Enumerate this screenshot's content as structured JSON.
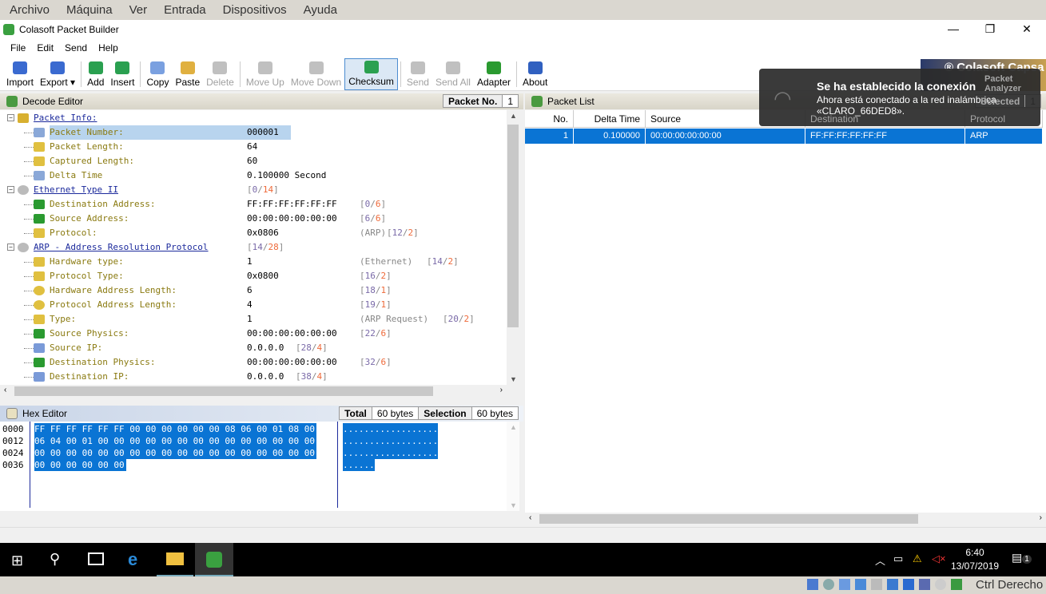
{
  "vbox_menu": [
    "Archivo",
    "Máquina",
    "Ver",
    "Entrada",
    "Dispositivos",
    "Ayuda"
  ],
  "app_title": "Colasoft Packet Builder",
  "menu": [
    "File",
    "Edit",
    "Send",
    "Help"
  ],
  "toolbar": [
    {
      "label": "Import",
      "state": "normal",
      "color": "#3a6ad0"
    },
    {
      "label": "Export ▾",
      "state": "normal",
      "color": "#3a6ad0"
    },
    {
      "sep": true
    },
    {
      "label": "Add",
      "state": "normal",
      "color": "#2aa050"
    },
    {
      "label": "Insert",
      "state": "normal",
      "color": "#2aa050"
    },
    {
      "sep": true
    },
    {
      "label": "Copy",
      "state": "normal",
      "color": "#7aa0e0"
    },
    {
      "label": "Paste",
      "state": "normal",
      "color": "#e0b040"
    },
    {
      "label": "Delete",
      "state": "disabled",
      "color": "#c0c0c0"
    },
    {
      "sep": true
    },
    {
      "label": "Move Up",
      "state": "disabled",
      "color": "#c0c0c0"
    },
    {
      "label": "Move Down",
      "state": "disabled",
      "color": "#c0c0c0"
    },
    {
      "label": "Checksum",
      "state": "active",
      "color": "#2aa050"
    },
    {
      "sep": true
    },
    {
      "label": "Send",
      "state": "disabled",
      "color": "#c0c0c0"
    },
    {
      "label": "Send All",
      "state": "disabled",
      "color": "#c0c0c0"
    },
    {
      "label": "Adapter",
      "state": "normal",
      "color": "#2a9a30"
    },
    {
      "sep": true
    },
    {
      "label": "About",
      "state": "normal",
      "color": "#3060c0"
    }
  ],
  "banner": "® Colasoft Capsa",
  "banner_sub": "Packet Analyzer",
  "decode_editor": {
    "title": "Decode Editor",
    "packet_no_label": "Packet No.",
    "packet_no": "1",
    "rows": [
      {
        "level": 0,
        "label": "Packet Info:",
        "icon": "packet-info",
        "header": true
      },
      {
        "level": 1,
        "label": "Packet Number:",
        "value": "000001",
        "icon": "document",
        "selected": true
      },
      {
        "level": 1,
        "label": "Packet Length:",
        "value": "64",
        "icon": "field"
      },
      {
        "level": 1,
        "label": "Captured Length:",
        "value": "60",
        "icon": "field"
      },
      {
        "level": 1,
        "label": "Delta Time",
        "value": "0.100000 Second",
        "icon": "document"
      },
      {
        "level": 0,
        "label": "Ethernet Type II",
        "icon": "protocol",
        "header": true,
        "rs": "0",
        "rl": "14"
      },
      {
        "level": 1,
        "label": "Destination Address:",
        "value": "FF:FF:FF:FF:FF:FF",
        "icon": "mac",
        "rs": "0",
        "rl": "6"
      },
      {
        "level": 1,
        "label": "Source Address:",
        "value": "00:00:00:00:00:00",
        "icon": "mac",
        "rs": "6",
        "rl": "6"
      },
      {
        "level": 1,
        "label": "Protocol:",
        "value": "0x0806",
        "extra": "(ARP)",
        "icon": "field",
        "rs": "12",
        "rl": "2"
      },
      {
        "level": 0,
        "label": "ARP - Address Resolution Protocol",
        "icon": "protocol",
        "header": true,
        "rs": "14",
        "rl": "28"
      },
      {
        "level": 1,
        "label": "Hardware type:",
        "value": "1",
        "extra": "(Ethernet)",
        "icon": "field",
        "rs": "14",
        "rl": "2"
      },
      {
        "level": 1,
        "label": "Protocol Type:",
        "value": "0x0800",
        "icon": "field",
        "rs": "16",
        "rl": "2"
      },
      {
        "level": 1,
        "label": "Hardware Address Length:",
        "value": "6",
        "icon": "round",
        "rs": "18",
        "rl": "1"
      },
      {
        "level": 1,
        "label": "Protocol Address Length:",
        "value": "4",
        "icon": "round",
        "rs": "19",
        "rl": "1"
      },
      {
        "level": 1,
        "label": "Type:",
        "value": "1",
        "extra": "(ARP Request)",
        "icon": "field",
        "rs": "20",
        "rl": "2"
      },
      {
        "level": 1,
        "label": "Source Physics:",
        "value": "00:00:00:00:00:00",
        "icon": "mac",
        "rs": "22",
        "rl": "6"
      },
      {
        "level": 1,
        "label": "Source IP:",
        "value": "0.0.0.0",
        "icon": "ip",
        "rs": "28",
        "rl": "4",
        "rinline": true
      },
      {
        "level": 1,
        "label": "Destination Physics:",
        "value": "00:00:00:00:00:00",
        "icon": "mac",
        "rs": "32",
        "rl": "6"
      },
      {
        "level": 1,
        "label": "Destination IP:",
        "value": "0.0.0.0",
        "icon": "ip",
        "rs": "38",
        "rl": "4",
        "rinline": true
      }
    ]
  },
  "hex_editor": {
    "title": "Hex Editor",
    "total_label": "Total",
    "total": "60 bytes",
    "selection_label": "Selection",
    "selection": "60 bytes",
    "rows": [
      {
        "offset": "0000",
        "hex": "FF FF FF FF FF FF 00 00 00 00 00 00 08 06 00 01 08 00",
        "ascii": ".................."
      },
      {
        "offset": "0012",
        "hex": "06 04 00 01 00 00 00 00 00 00 00 00 00 00 00 00 00 00",
        "ascii": ".................."
      },
      {
        "offset": "0024",
        "hex": "00 00 00 00 00 00 00 00 00 00 00 00 00 00 00 00 00 00",
        "ascii": ".................."
      },
      {
        "offset": "0036",
        "hex": "00 00 00 00 00 00",
        "ascii": "......"
      }
    ]
  },
  "packet_list": {
    "title": "Packet List",
    "selected_label": "Selected",
    "selected": "1",
    "columns": [
      "No.",
      "Delta Time",
      "Source",
      "Destination",
      "Protocol"
    ],
    "rows": [
      {
        "no": "1",
        "delta": "0.100000",
        "source": "00:00:00:00:00:00",
        "destination": "FF:FF:FF:FF:FF:FF",
        "protocol": "ARP"
      }
    ]
  },
  "toast": {
    "title": "Se ha establecido la conexión",
    "line1": "Ahora está conectado a la red inalámbrica",
    "line2": "«CLARO_66DED8»."
  },
  "taskbar": {
    "time": "6:40",
    "date": "13/07/2019",
    "notifications": "1"
  },
  "vbox_status": {
    "host_key": "Ctrl Derecho"
  }
}
